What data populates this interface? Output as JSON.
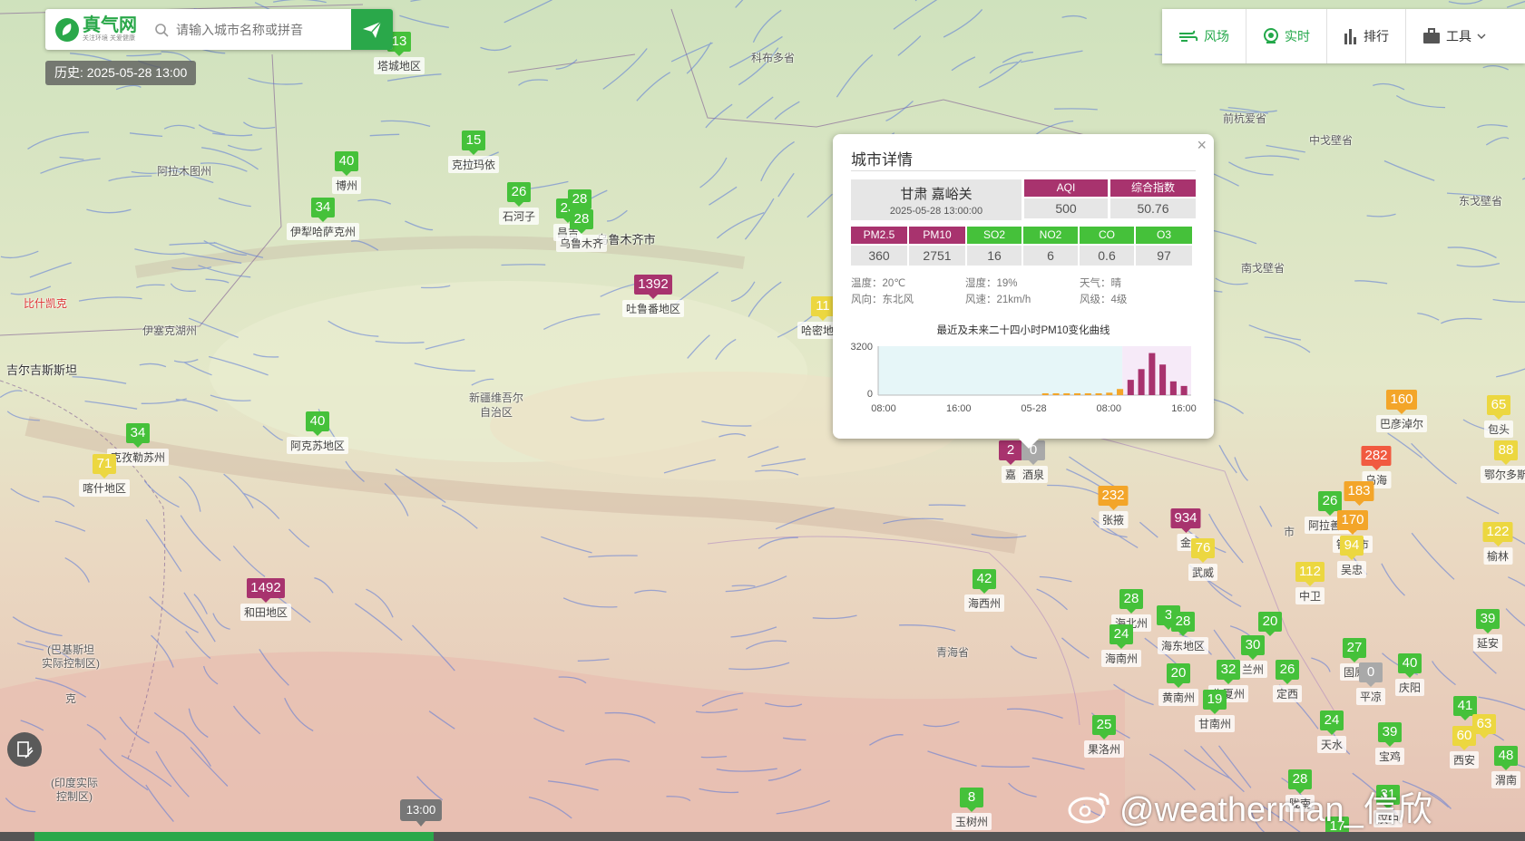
{
  "logo": {
    "title": "真气网",
    "subtitle": "关注环境 关爱健康"
  },
  "search": {
    "placeholder": "请输入城市名称或拼音"
  },
  "history_label": "历史: 2025-05-28 13:00",
  "toolbar": [
    {
      "label": "风场",
      "icon": "wind-icon"
    },
    {
      "label": "实时",
      "icon": "realtime-icon"
    },
    {
      "label": "排行",
      "icon": "ranking-icon"
    },
    {
      "label": "工具",
      "icon": "toolbox-icon"
    }
  ],
  "colors": {
    "good": "#45c13a",
    "moderate": "#ecd740",
    "sensitive": "#f3a529",
    "unhealthy": "#f15a40",
    "hazardous": "#a8336e",
    "nodata": "#a9a9a9",
    "brand": "#2aa84a"
  },
  "place_labels": [
    "科布多省",
    "前杭爱省",
    "中戈壁省",
    "东戈壁省",
    "南戈壁省",
    "阿拉木图州",
    "比什凯克",
    "伊塞克湖州",
    "吉尔吉斯斯坦",
    "新疆维吾尔",
    "自治区",
    "乌鲁木齐市",
    "青海省",
    "(巴基斯坦",
    "实际控制区)",
    "克",
    "(印度实际",
    "控制区)",
    "市",
    "市"
  ],
  "markers": [
    {
      "value": "13",
      "level": "good",
      "name": "塔城地区"
    },
    {
      "value": "15",
      "level": "good",
      "name": "克拉玛依"
    },
    {
      "value": "40",
      "level": "good",
      "name": "博州"
    },
    {
      "value": "34",
      "level": "good",
      "name": "伊犁哈萨克州"
    },
    {
      "value": "26",
      "level": "good",
      "name": "石河子"
    },
    {
      "value": "23",
      "level": "good",
      "name": "昌吉"
    },
    {
      "value": "28",
      "level": "good",
      "name": ""
    },
    {
      "value": "28",
      "level": "good",
      "name": "乌鲁木齐"
    },
    {
      "value": "1392",
      "level": "hazardous",
      "name": "吐鲁番地区"
    },
    {
      "value": "11",
      "level": "moderate",
      "name": "哈密地区"
    },
    {
      "value": "40",
      "level": "good",
      "name": "阿克苏地区"
    },
    {
      "value": "34",
      "level": "good",
      "name": "克孜勒苏州"
    },
    {
      "value": "71",
      "level": "moderate",
      "name": "喀什地区"
    },
    {
      "value": "1492",
      "level": "hazardous",
      "name": "和田地区"
    },
    {
      "value": "2",
      "level": "hazardous",
      "name": "嘉"
    },
    {
      "value": "0",
      "level": "nodata",
      "name": "酒泉"
    },
    {
      "value": "232",
      "level": "sensitive",
      "name": "张掖"
    },
    {
      "value": "934",
      "level": "hazardous",
      "name": "金"
    },
    {
      "value": "76",
      "level": "moderate",
      "name": "武威"
    },
    {
      "value": "42",
      "level": "good",
      "name": "海西州"
    },
    {
      "value": "28",
      "level": "good",
      "name": "海北州"
    },
    {
      "value": "3",
      "level": "good",
      "name": ""
    },
    {
      "value": "28",
      "level": "good",
      "name": "海东地区"
    },
    {
      "value": "24",
      "level": "good",
      "name": "海南州"
    },
    {
      "value": "20",
      "level": "good",
      "name": ""
    },
    {
      "value": "30",
      "level": "good",
      "name": "兰州"
    },
    {
      "value": "20",
      "level": "good",
      "name": "黄南州"
    },
    {
      "value": "32",
      "level": "good",
      "name": "临夏州"
    },
    {
      "value": "26",
      "level": "good",
      "name": "定西"
    },
    {
      "value": "19",
      "level": "good",
      "name": "甘南州"
    },
    {
      "value": "25",
      "level": "good",
      "name": "果洛州"
    },
    {
      "value": "27",
      "level": "good",
      "name": "固原"
    },
    {
      "value": "0",
      "level": "nodata",
      "name": "平凉"
    },
    {
      "value": "40",
      "level": "good",
      "name": "庆阳"
    },
    {
      "value": "24",
      "level": "good",
      "name": "天水"
    },
    {
      "value": "39",
      "level": "good",
      "name": "宝鸡"
    },
    {
      "value": "8",
      "level": "good",
      "name": "玉树州"
    },
    {
      "value": "28",
      "level": "good",
      "name": "陇南"
    },
    {
      "value": "160",
      "level": "sensitive",
      "name": "巴彦淖尔"
    },
    {
      "value": "282",
      "level": "unhealthy",
      "name": "乌海"
    },
    {
      "value": "183",
      "level": "sensitive",
      "name": ""
    },
    {
      "value": "26",
      "level": "good",
      "name": "阿拉善盟"
    },
    {
      "value": "170",
      "level": "sensitive",
      "name": "银川市"
    },
    {
      "value": "94",
      "level": "moderate",
      "name": "吴忠"
    },
    {
      "value": "112",
      "level": "moderate",
      "name": "中卫"
    },
    {
      "value": "65",
      "level": "moderate",
      "name": "包头"
    },
    {
      "value": "88",
      "level": "moderate",
      "name": "鄂尔多斯"
    },
    {
      "value": "122",
      "level": "moderate",
      "name": "榆林"
    },
    {
      "value": "39",
      "level": "good",
      "name": "延安"
    },
    {
      "value": "41",
      "level": "good",
      "name": ""
    },
    {
      "value": "63",
      "level": "moderate",
      "name": ""
    },
    {
      "value": "60",
      "level": "moderate",
      "name": "西安"
    },
    {
      "value": "48",
      "level": "good",
      "name": "渭南"
    },
    {
      "value": "17",
      "level": "good",
      "name": ""
    },
    {
      "value": "31",
      "level": "good",
      "name": "汉中"
    }
  ],
  "popup": {
    "title": "城市详情",
    "close": "×",
    "city": "甘肃 嘉峪关",
    "time": "2025-05-28 13:00:00",
    "indices": [
      {
        "label": "AQI",
        "value": "500",
        "level": "hazardous"
      },
      {
        "label": "综合指数",
        "value": "50.76",
        "level": "hazardous"
      }
    ],
    "pollutants": [
      {
        "label": "PM2.5",
        "value": "360",
        "level": "hazardous"
      },
      {
        "label": "PM10",
        "value": "2751",
        "level": "hazardous"
      },
      {
        "label": "SO2",
        "value": "16",
        "level": "good"
      },
      {
        "label": "NO2",
        "value": "6",
        "level": "good"
      },
      {
        "label": "CO",
        "value": "0.6",
        "level": "good"
      },
      {
        "label": "O3",
        "value": "97",
        "level": "good"
      }
    ],
    "meteo": {
      "temp": "温度：20℃",
      "humidity": "湿度：19%",
      "weather": "天气：晴",
      "wind_dir": "风向：东北风",
      "wind_speed": "风速：21km/h",
      "wind_level": "风级：4级"
    },
    "chart_title": "最近及未来二十四小时PM10变化曲线"
  },
  "chart_data": {
    "type": "bar",
    "title": "最近及未来二十四小时PM10变化曲线",
    "ylim": [
      0,
      3200
    ],
    "yticks": [
      "3200",
      "0"
    ],
    "xticks": [
      "08:00",
      "16:00",
      "05-28",
      "08:00",
      "16:00"
    ],
    "categories": [
      "05-27 14:00",
      "15:00",
      "16:00",
      "17:00",
      "18:00",
      "19:00",
      "20:00",
      "21:00",
      "22:00",
      "23:00",
      "05-28 00:00",
      "01:00",
      "02:00",
      "03:00",
      "04:00",
      "05:00",
      "06:00",
      "07:00",
      "08:00",
      "09:00",
      "10:00",
      "11:00",
      "12:00",
      "13:00",
      "14:00",
      "15:00",
      "16:00",
      "17:00"
    ],
    "values": [
      0,
      0,
      0,
      0,
      0,
      0,
      0,
      0,
      0,
      0,
      0,
      0,
      0,
      0,
      0,
      60,
      80,
      60,
      120,
      60,
      100,
      160,
      400,
      1000,
      1700,
      2750,
      2000,
      900,
      600
    ],
    "series_colors": {
      "low": "#f3a529",
      "high": "#a8336e"
    }
  },
  "timeline": {
    "current": "13:00"
  },
  "watermark": "@weatherman_信欣"
}
